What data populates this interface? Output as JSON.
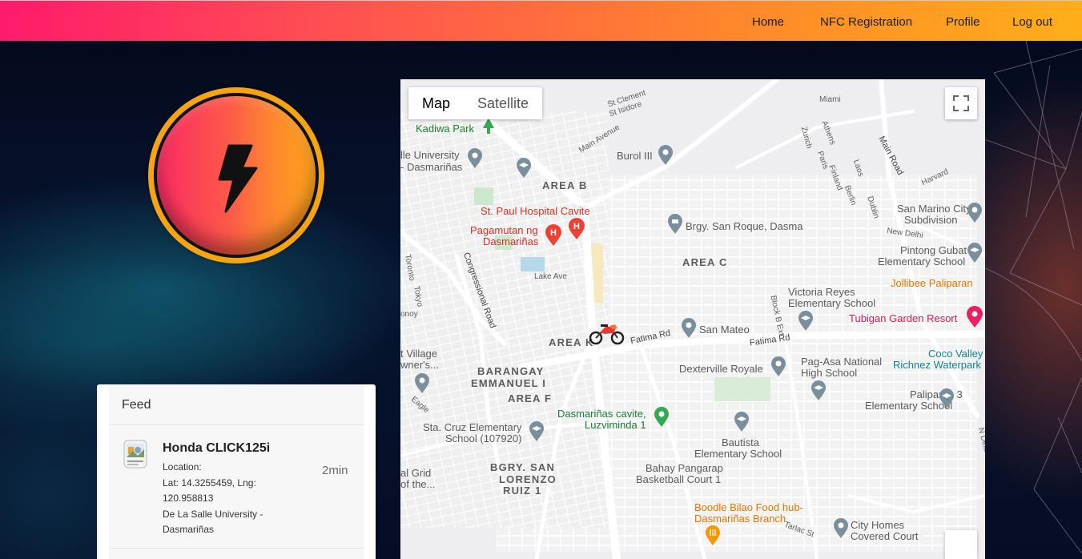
{
  "nav": {
    "items": [
      {
        "label": "Home"
      },
      {
        "label": "NFC Registration"
      },
      {
        "label": "Profile"
      },
      {
        "label": "Log out"
      }
    ]
  },
  "logo": {
    "icon": "lightning-bolt-icon"
  },
  "map": {
    "type_buttons": {
      "map": "Map",
      "satellite": "Satellite"
    },
    "active_type": "Map",
    "areas": {
      "b": "AREA B",
      "c": "AREA C",
      "k": "AREA K",
      "f": "AREA F",
      "emmanuel_1": "BARANGAY",
      "emmanuel_2": "EMMANUEL I",
      "lorenzo_1": "BGRY. SAN",
      "lorenzo_2": "LORENZO",
      "lorenzo_3": "RUIZ 1"
    },
    "pois": {
      "kadiwa": "Kadiwa Park",
      "dlsu_1": "lle University",
      "dlsu_2": "- Dasmariñas",
      "burol": "Burol III",
      "st_paul": "St. Paul Hospital Cavite",
      "pagamutan_1": "Pagamutan ng",
      "pagamutan_2": "Dasmariñas",
      "san_roque": "Brgy. San Roque, Dasma",
      "san_marino_1": "San Marino City",
      "san_marino_2": "Subdivision",
      "pintong_1": "Pintong Gubat",
      "pintong_2": "Elementary School",
      "jollibee": "Jollibee Paliparan",
      "victoria_1": "Victoria Reyes",
      "victoria_2": "Elementary School",
      "tubigan": "Tubigan Garden Resort",
      "san_mateo": "San Mateo",
      "coco_1": "Coco Valley",
      "coco_2": "Richnez Waterpark",
      "dexterville": "Dexterville Royale",
      "pagasa_1": "Pag-Asa National",
      "pagasa_2": "High School",
      "village_1": "t Village",
      "village_2": "wner's...",
      "paliparan3_1": "Paliparan 3",
      "paliparan3_2": "Elementary School",
      "dasma_cavite_1": "Dasmariñas cavite,",
      "dasma_cavite_2": "Luzviminda 1",
      "sta_cruz_1": "Sta. Cruz Elementary",
      "sta_cruz_2": "School (107920)",
      "bautista_1": "Bautista",
      "bautista_2": "Elementary School",
      "bahay_1": "Bahay Pangarap",
      "bahay_2": "Basketball Court 1",
      "grid_1": "al Grid",
      "grid_2": "of the...",
      "boodle_1": "Boodle Bilao Food hub-",
      "boodle_2": "Dasmariñas Branch",
      "city_homes_1": "City Homes",
      "city_homes_2": "Covered Court",
      "lake_ave": "Lake Ave"
    },
    "streets": {
      "st_clement": "St Clement",
      "st_isidore": "St Isidore",
      "miami": "Miami",
      "main_avenue": "Main Avenue",
      "zurich": "Zurich",
      "athens": "Athens",
      "paris": "Paris",
      "finland": "Finland",
      "laos": "Laos",
      "berlin": "Berlin",
      "dublin": "Dublin",
      "main_road": "Main Road",
      "harvard": "Harvard",
      "new_delhi": "New Delhi",
      "congressional": "Congressional Road",
      "toronto": "Toronto",
      "tokyo": "Tokyo",
      "sonoy": "onoy",
      "fatima_1": "Fatima Rd",
      "fatima_2": "Fatima Rd",
      "block_b": "Block B Ext",
      "eagle": "Eagle",
      "n_dela": "N Dela",
      "tarlac": "Tarlac St"
    }
  },
  "feed": {
    "title": "Feed",
    "items": [
      {
        "title": "Honda CLICK125i",
        "location_label": "Location:",
        "coords": "Lat: 14.3255459, Lng: 120.958813",
        "place": "De La Salle University - Dasmariñas",
        "time": "2min"
      }
    ]
  },
  "colors": {
    "nav_gradient_start": "#ff1a6b",
    "nav_gradient_end": "#ffae1a",
    "logo_ring": "#f5a514"
  }
}
